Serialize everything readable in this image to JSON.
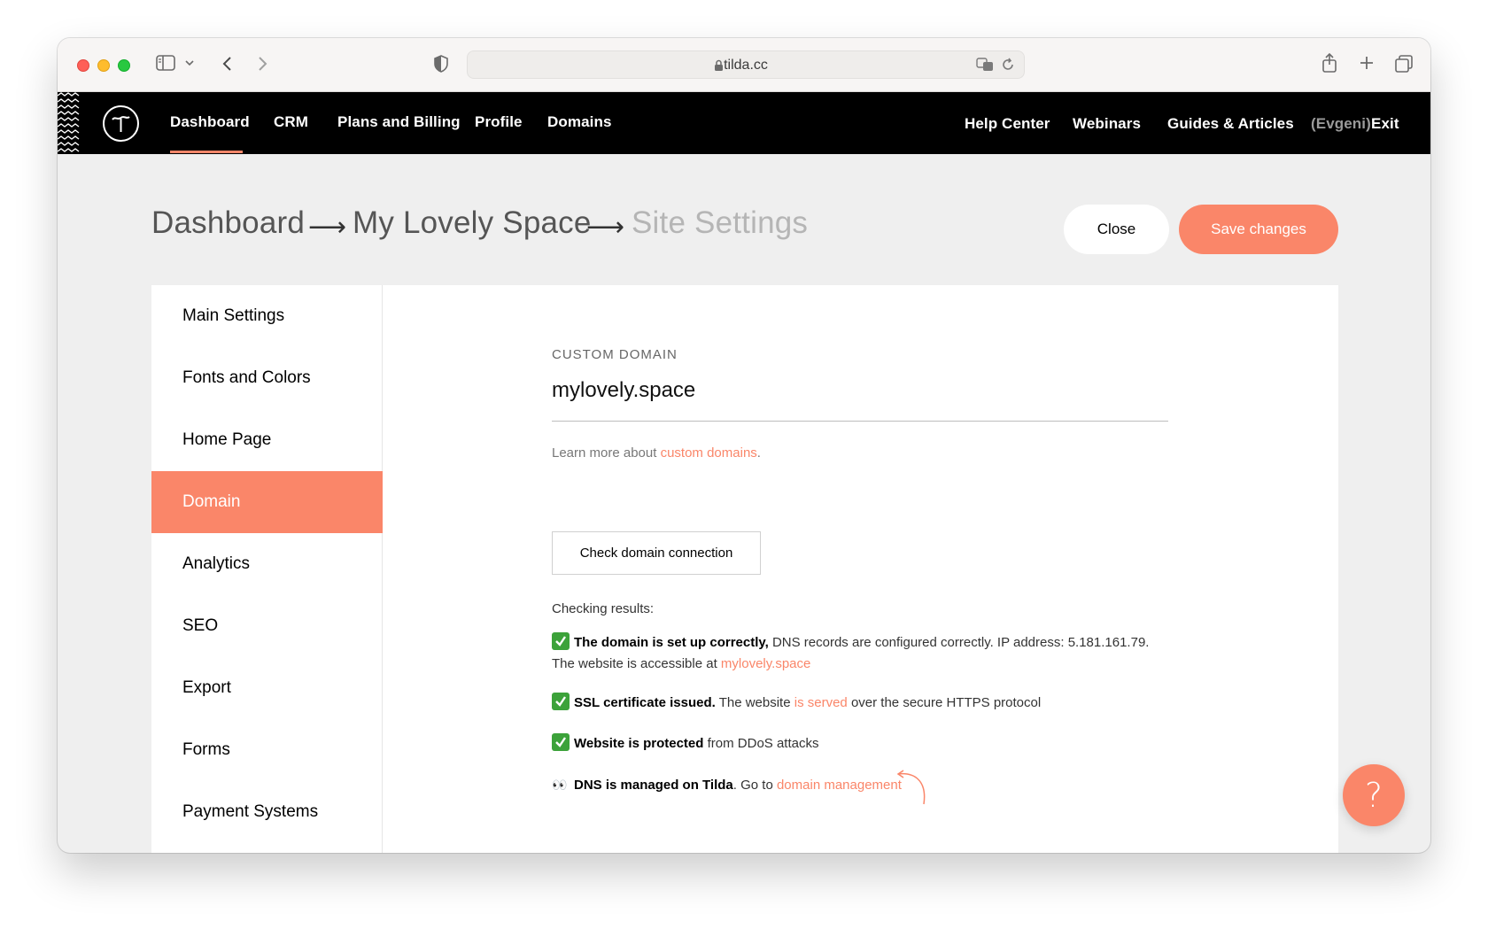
{
  "browser": {
    "url": "tilda.cc"
  },
  "nav": {
    "left": [
      "Dashboard",
      "CRM",
      "Plans and Billing",
      "Profile",
      "Domains"
    ],
    "right": [
      "Help Center",
      "Webinars",
      "Guides & Articles"
    ],
    "user": "(Evgeni)",
    "exit": "Exit"
  },
  "breadcrumb": {
    "items": [
      "Dashboard",
      "My Lovely Space",
      "Site Settings"
    ],
    "separator": "⟶"
  },
  "actions": {
    "close": "Close",
    "save": "Save changes"
  },
  "sidebar": {
    "items": [
      "Main Settings",
      "Fonts and Colors",
      "Home Page",
      "Domain",
      "Analytics",
      "SEO",
      "Export",
      "Forms",
      "Payment Systems"
    ],
    "active": "Domain"
  },
  "domain": {
    "label": "CUSTOM DOMAIN",
    "value": "mylovely.space",
    "learn_prefix": "Learn more about ",
    "learn_link": "custom domains",
    "learn_suffix": ".",
    "check_button": "Check domain connection",
    "results_title": "Checking results:",
    "results": {
      "r1_bold": "The domain is set up correctly,",
      "r1_text": " DNS records are configured correctly. IP address: 5.181.161.79.",
      "r1_line2": "The website is accessible at ",
      "r1_link": "mylovely.space",
      "r2_bold": "SSL certificate issued.",
      "r2_text": " The website ",
      "r2_link": "is served",
      "r2_tail": " over the secure HTTPS protocol",
      "r3_bold": "Website is protected",
      "r3_text": " from DDoS attacks",
      "r4_emoji": "👀",
      "r4_bold": "DNS is managed on Tilda",
      "r4_text": ". Go to ",
      "r4_link": "domain management"
    }
  },
  "help": {
    "label": "?"
  },
  "colors": {
    "accent": "#fa8669",
    "nav_bg": "#000000",
    "page_bg": "#efefef",
    "check_green": "#3ca23a"
  }
}
